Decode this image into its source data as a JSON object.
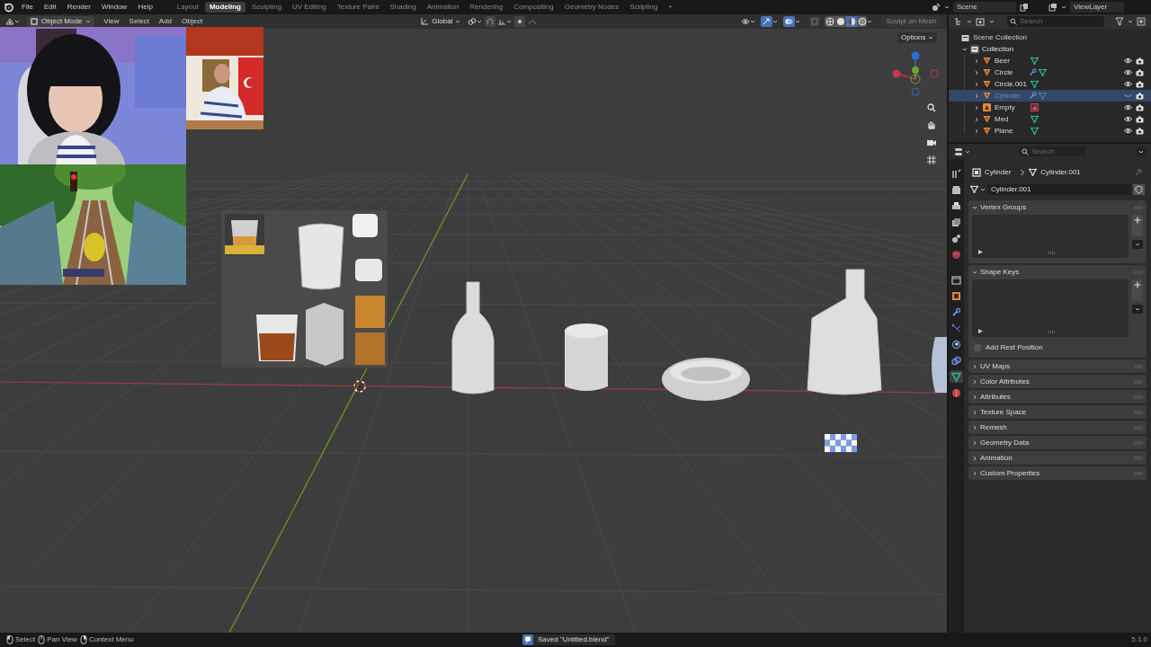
{
  "top_bar": {
    "menus": [
      "File",
      "Edit",
      "Render",
      "Window",
      "Help"
    ],
    "workspaces": [
      {
        "label": "Layout",
        "selected": false
      },
      {
        "label": "Modeling",
        "selected": true
      },
      {
        "label": "Sculpting",
        "selected": false
      },
      {
        "label": "UV Editing",
        "selected": false
      },
      {
        "label": "Texture Paint",
        "selected": false
      },
      {
        "label": "Shading",
        "selected": false
      },
      {
        "label": "Animation",
        "selected": false
      },
      {
        "label": "Rendering",
        "selected": false
      },
      {
        "label": "Compositing",
        "selected": false
      },
      {
        "label": "Geometry Nodes",
        "selected": false
      },
      {
        "label": "Scripting",
        "selected": false
      }
    ],
    "add_tab": "+",
    "scene": "Scene",
    "view_layer": "ViewLayer"
  },
  "viewport_header": {
    "mode": "Object Mode",
    "menus": [
      "View",
      "Select",
      "Add",
      "Object"
    ],
    "orientation": "Global",
    "shading_modes": [
      {
        "selected": false
      },
      {
        "selected": false
      },
      {
        "selected": true
      },
      {
        "selected": false
      }
    ],
    "sculpt_button": {
      "label": "Sculpt on Mesh",
      "disabled": true
    }
  },
  "viewport": {
    "options": "Options"
  },
  "outliner": {
    "search_placeholder": "Search",
    "scene_collection": "Scene Collection",
    "collection": {
      "label": "Collection",
      "expanded": true
    },
    "items": [
      {
        "name": "Beer",
        "kind": "mesh",
        "modifier": false,
        "selected": false,
        "hidden": false
      },
      {
        "name": "Circle",
        "kind": "mesh",
        "modifier": true,
        "selected": false,
        "hidden": false
      },
      {
        "name": "Circle.001",
        "kind": "mesh",
        "modifier": false,
        "selected": false,
        "hidden": false
      },
      {
        "name": "Cylinder",
        "kind": "mesh",
        "modifier": true,
        "selected": true,
        "hidden": true
      },
      {
        "name": "Empty",
        "kind": "empty",
        "modifier": false,
        "selected": false,
        "hidden": false
      },
      {
        "name": "Med",
        "kind": "mesh",
        "modifier": false,
        "selected": false,
        "hidden": false
      },
      {
        "name": "Plane",
        "kind": "mesh",
        "modifier": false,
        "selected": false,
        "hidden": false
      }
    ]
  },
  "properties": {
    "search_placeholder": "Search",
    "breadcrumb": [
      "Cylinder",
      "Cylinder.001"
    ],
    "data_name": "Cylinder.001",
    "tabs": [
      {
        "selected": false
      },
      {
        "selected": false
      },
      {
        "selected": false
      },
      {
        "selected": false
      },
      {
        "selected": false
      },
      {
        "selected": false
      },
      {
        "selected": false
      },
      {
        "selected": false
      },
      {
        "selected": false
      },
      {
        "selected": false
      },
      {
        "selected": false
      },
      {
        "selected": false
      },
      {
        "selected": true
      },
      {
        "selected": false
      }
    ],
    "panels": [
      {
        "title": "Vertex Groups",
        "expanded": true
      },
      {
        "title": "Shape Keys",
        "expanded": true,
        "checkbox": {
          "label": "Add Rest Position",
          "checked": false
        }
      },
      {
        "title": "UV Maps",
        "expanded": false
      },
      {
        "title": "Color Attributes",
        "expanded": false
      },
      {
        "title": "Attributes",
        "expanded": false
      },
      {
        "title": "Texture Space",
        "expanded": false
      },
      {
        "title": "Remesh",
        "expanded": false
      },
      {
        "title": "Geometry Data",
        "expanded": false
      },
      {
        "title": "Animation",
        "expanded": false
      },
      {
        "title": "Custom Properties",
        "expanded": false
      }
    ]
  },
  "status_bar": {
    "hints": [
      "Select",
      "Pan View",
      "Context Menu"
    ],
    "message": "Saved \"Untitled.blend\"",
    "version": "5.1.0"
  }
}
